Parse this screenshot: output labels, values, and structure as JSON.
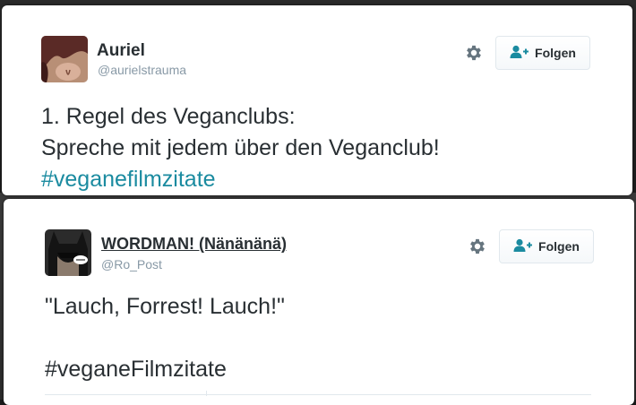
{
  "tweets": [
    {
      "author": {
        "name": "Auriel",
        "handle": "@aurielstrauma"
      },
      "follow_label": "Folgen",
      "text_lines": [
        "1. Regel des Veganclubs:",
        "Spreche mit jedem über den Veganclub!"
      ],
      "hashtag": "#veganefilmzitate",
      "colors": {
        "hashtag": "#1b8ba0"
      }
    },
    {
      "author": {
        "name": "WORDMAN! (Nänänänä)",
        "handle": "@Ro_Post"
      },
      "follow_label": "Folgen",
      "text_lines": [
        "\"Lauch, Forrest! Lauch!\""
      ],
      "hashtag": "#veganeFilmzitate"
    }
  ],
  "icons": {
    "settings": "gear-icon",
    "follow": "user-plus-icon"
  }
}
